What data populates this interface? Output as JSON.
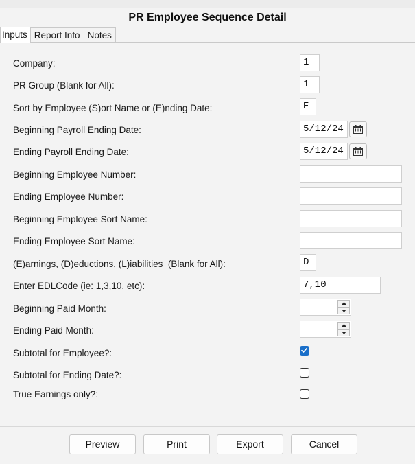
{
  "window": {
    "title": "PR Employee Sequence Detail"
  },
  "tabs": [
    {
      "label": "Inputs"
    },
    {
      "label": "Report Info"
    },
    {
      "label": "Notes"
    }
  ],
  "fields": {
    "company": {
      "label": "Company:",
      "value": "1"
    },
    "pr_group": {
      "label": "PR Group (Blank for All):",
      "value": "1"
    },
    "sort_by": {
      "label": "Sort by Employee (S)ort Name or (E)nding Date:",
      "value": "E"
    },
    "begin_payroll_end_date": {
      "label": "Beginning Payroll Ending Date:",
      "value": "5/12/24"
    },
    "end_payroll_end_date": {
      "label": "Ending Payroll Ending Date:",
      "value": "5/12/24"
    },
    "begin_employee_number": {
      "label": "Beginning Employee Number:",
      "value": ""
    },
    "end_employee_number": {
      "label": "Ending Employee Number:",
      "value": ""
    },
    "begin_employee_sort_name": {
      "label": "Beginning Employee Sort Name:",
      "value": ""
    },
    "end_employee_sort_name": {
      "label": "Ending Employee Sort Name:",
      "value": ""
    },
    "edl_type": {
      "label": "(E)arnings, (D)eductions, (L)iabilities  (Blank for All):",
      "value": "D"
    },
    "edl_code": {
      "label": "Enter EDLCode (ie: 1,3,10, etc):",
      "value": "7,10"
    },
    "begin_paid_month": {
      "label": "Beginning Paid Month:",
      "value": ""
    },
    "end_paid_month": {
      "label": "Ending Paid Month:",
      "value": ""
    },
    "subtotal_employee": {
      "label": "Subtotal for Employee?:",
      "checked": true
    },
    "subtotal_ending_date": {
      "label": "Subtotal for Ending Date?:",
      "checked": false
    },
    "true_earnings_only": {
      "label": "True Earnings only?:",
      "checked": false
    }
  },
  "buttons": {
    "preview": "Preview",
    "print": "Print",
    "export": "Export",
    "cancel": "Cancel"
  },
  "icons": {
    "calendar": "calendar-icon",
    "spin_up": "spin-up-icon",
    "spin_down": "spin-down-icon",
    "check": "checkmark-icon"
  },
  "colors": {
    "accent": "#1a6fc9",
    "background": "#f3f3f3"
  }
}
